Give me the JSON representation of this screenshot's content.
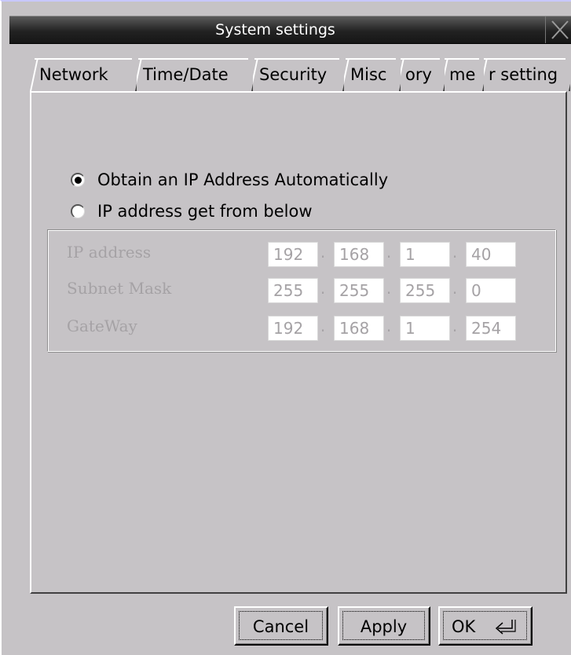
{
  "window": {
    "title": "System settings"
  },
  "tabs": [
    {
      "label": "Network",
      "active": true
    },
    {
      "label": "Time/Date",
      "active": false
    },
    {
      "label": "Security",
      "active": false
    },
    {
      "label": "Misc",
      "active": false
    },
    {
      "label": "ory",
      "active": false
    },
    {
      "label": "me",
      "active": false
    },
    {
      "label": "r setting",
      "active": false
    }
  ],
  "network": {
    "radio_auto": {
      "label": "Obtain an IP Address Automatically",
      "checked": true
    },
    "radio_manual": {
      "label": "IP address get from below",
      "checked": false
    },
    "fields": [
      {
        "label": "IP address",
        "octets": [
          "192",
          "168",
          "1",
          "40"
        ]
      },
      {
        "label": "Subnet Mask",
        "octets": [
          "255",
          "255",
          "255",
          "0"
        ]
      },
      {
        "label": "GateWay",
        "octets": [
          "192",
          "168",
          "1",
          "254"
        ]
      }
    ],
    "separator": "."
  },
  "buttons": {
    "cancel": "Cancel",
    "apply": "Apply",
    "ok": "OK"
  },
  "icons": {
    "close": "close-icon",
    "enter": "enter-icon"
  }
}
